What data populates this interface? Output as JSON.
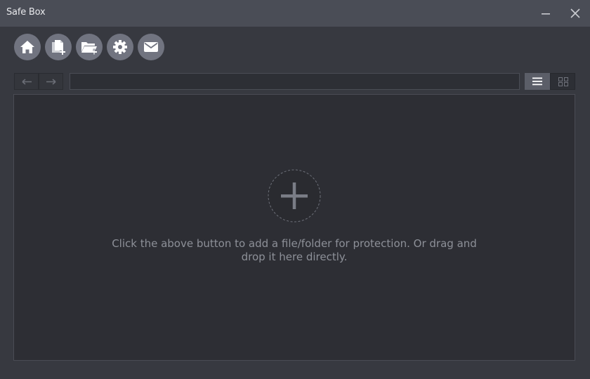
{
  "window": {
    "title": "Safe Box",
    "controls": {
      "minimize": "minimize-icon",
      "close": "close-icon"
    }
  },
  "toolbar": {
    "buttons": [
      {
        "name": "home",
        "icon": "home-icon"
      },
      {
        "name": "add-file",
        "icon": "add-file-icon"
      },
      {
        "name": "add-folder",
        "icon": "add-folder-icon"
      },
      {
        "name": "settings",
        "icon": "gear-icon"
      },
      {
        "name": "mail",
        "icon": "mail-icon"
      }
    ]
  },
  "navigation": {
    "back_icon": "arrow-left-icon",
    "forward_icon": "arrow-right-icon",
    "path_value": "",
    "view_modes": [
      "list",
      "grid"
    ],
    "active_view": "list"
  },
  "content": {
    "add_icon": "plus-icon",
    "hint": "Click the above button to add a file/folder for protection. Or drag and drop it here directly."
  },
  "colors": {
    "background": "#373940",
    "titlebar": "#4a4d56",
    "panel": "#2d2e34",
    "button": "#717480",
    "text_muted": "#8d9098"
  }
}
